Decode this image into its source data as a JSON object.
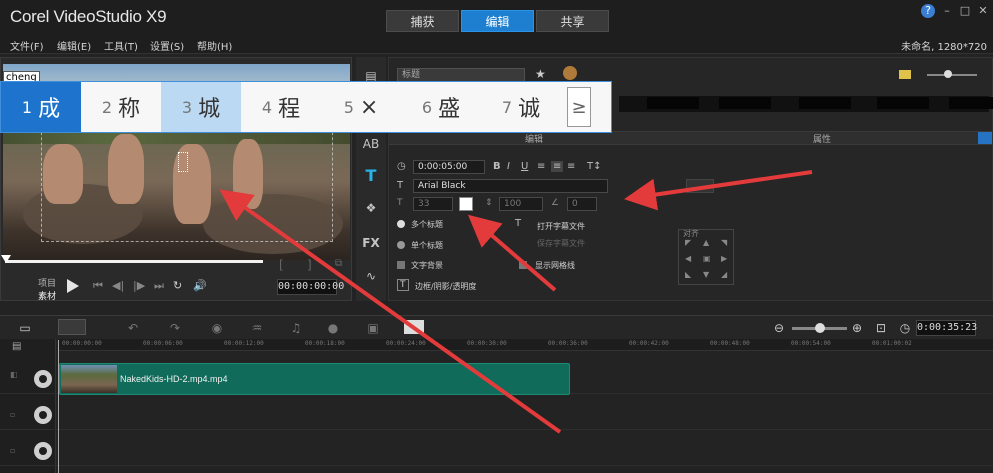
{
  "app": {
    "title": "Corel VideoStudio X9"
  },
  "tabs": [
    {
      "label": "捕获",
      "active": false
    },
    {
      "label": "编辑",
      "active": true
    },
    {
      "label": "共享",
      "active": false
    }
  ],
  "menu": [
    "文件(F)",
    "编辑(E)",
    "工具(T)",
    "设置(S)",
    "帮助(H)"
  ],
  "project_info": "未命名, 1280*720",
  "preview": {
    "ime_input": "cheng",
    "project_label": "项目",
    "clip_label": "素材",
    "timecode": "00:00:00:00"
  },
  "ime_candidates": [
    {
      "num": "1",
      "char": "成"
    },
    {
      "num": "2",
      "char": "称"
    },
    {
      "num": "3",
      "char": "城"
    },
    {
      "num": "4",
      "char": "程"
    },
    {
      "num": "5",
      "char": "×"
    },
    {
      "num": "6",
      "char": "盛"
    },
    {
      "num": "7",
      "char": "诚"
    }
  ],
  "ime_next": "≥",
  "options": {
    "library_select": "标题",
    "subtab_edit": "编辑",
    "subtab_attr": "属性",
    "duration": "0:00:05:00",
    "font": "Arial Black",
    "font_size": "33",
    "line_spacing": "100",
    "angle": "0",
    "open_subtitle": "打开字幕文件",
    "save_subtitle": "保存字幕文件",
    "multi_title": "多个标题",
    "single_title": "单个标题",
    "text_bg": "文字背景",
    "show_grid": "显示网格线",
    "border_shadow": "边框/阴影/透明度",
    "align_label": "对齐"
  },
  "timeline": {
    "timecode": "0:00:35:23",
    "ruler_ticks": [
      "00:00:00:00",
      "00:00:06:00",
      "00:00:12:00",
      "00:00:18:00",
      "00:00:24:00",
      "00:00:30:00",
      "00:00:36:00",
      "00:00:42:00",
      "00:00:48:00",
      "00:00:54:00",
      "00:01:00:02"
    ],
    "clip_name": "NakedKids-HD-2.mp4.mp4"
  },
  "colors": {
    "accent": "#1e7fd0",
    "clip": "#116b5a",
    "arrow": "#e33b3b"
  }
}
